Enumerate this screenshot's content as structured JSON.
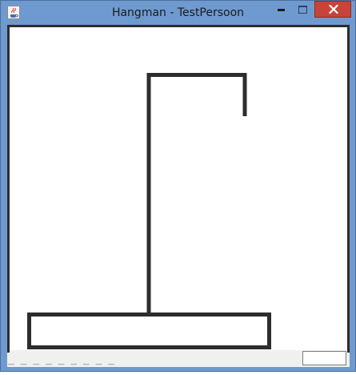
{
  "window": {
    "title": "Hangman - TestPersoon",
    "app_icon": "java-cup-icon",
    "controls": {
      "minimize_icon": "minimize-icon",
      "maximize_icon": "maximize-icon",
      "close_icon": "close-icon"
    }
  },
  "game": {
    "word_mask": "_ _ _ _ _ _ _ _ _",
    "guess_input": {
      "value": "",
      "placeholder": ""
    },
    "drawing_parts_visible": [
      "base",
      "pole",
      "beam",
      "rope"
    ]
  },
  "colors": {
    "title_bar": "#6f9ad0",
    "close_button": "#c7443a",
    "drawing_stroke": "#2d2d2d",
    "canvas": "#ffffff",
    "status_bar": "#f0f0f0"
  }
}
